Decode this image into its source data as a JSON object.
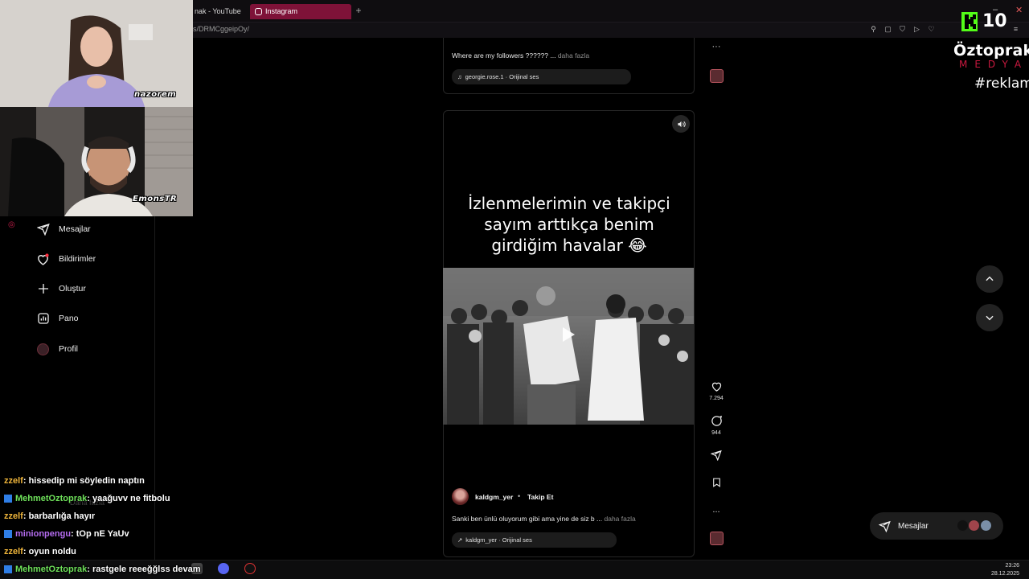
{
  "browser": {
    "tabs": [
      {
        "label": "nak - YouTube"
      },
      {
        "label": "Instagram",
        "active": true
      }
    ],
    "new_tab": "+",
    "url": "ls/DRMCggeipOy/"
  },
  "sidebar": {
    "items": [
      {
        "label": "Mesajlar",
        "icon": "send-icon"
      },
      {
        "label": "Bildirimler",
        "icon": "heart-icon"
      },
      {
        "label": "Oluştur",
        "icon": "plus-icon"
      },
      {
        "label": "Pano",
        "icon": "chart-icon"
      },
      {
        "label": "Profil",
        "icon": "avatar"
      }
    ]
  },
  "previous_post": {
    "caption": "Where are my followers ?????? ...",
    "more": "daha fazla",
    "audio": "georgie.rose.1 · Orijinal ses"
  },
  "reel": {
    "headline": "İzlenmelerimin ve takipçi sayım arttıkça benim girdiğim havalar 😂",
    "author": "kaldgm_yer",
    "separator": "•",
    "follow_label": "Takip Et",
    "caption": "Sanki ben ünlü oluyorum gibi ama yine de siz b ...",
    "more": "daha fazla",
    "audio": "kaldgm_yer · Orijinal ses"
  },
  "actions": {
    "likes": "7.294",
    "comments": "944",
    "more": "..."
  },
  "messages_pill": {
    "label": "Mesajlar"
  },
  "stream": {
    "cam_tags": [
      "nazorem",
      "EmonsTR"
    ],
    "k_count": "10",
    "brand": "Öztoprak",
    "brand_sub": "MEDYA",
    "hashtag": "#reklam",
    "chat": [
      {
        "user": "zzelf",
        "color": "#f0b63b",
        "text": " : hissedip mi söyledin naptın",
        "badge": false
      },
      {
        "user": "MehmetOztoprak",
        "color": "#6ee05a",
        "text": " : yaağuvv ne fitbolu",
        "badge": true
      },
      {
        "user": "zzelf",
        "color": "#f0b63b",
        "text": " : barbarlığa hayır",
        "badge": false
      },
      {
        "user": "minionpengu",
        "color": "#b56cf0",
        "text": " : tOp nE YaUv",
        "badge": true
      },
      {
        "user": "zzelf",
        "color": "#f0b63b",
        "text": " : oyun noldu",
        "badge": false
      },
      {
        "user": "MehmetOztoprak",
        "color": "#6ee05a",
        "text": " : rastgele reeeğğlss devam",
        "badge": true
      }
    ],
    "ghost_text": "Daha fazla"
  },
  "taskbar": {
    "time": "23:26",
    "date": "28.12.2025"
  },
  "colors": {
    "accent": "#7e1238",
    "kick_green": "#53fc18",
    "brand_red": "#c8193f"
  }
}
